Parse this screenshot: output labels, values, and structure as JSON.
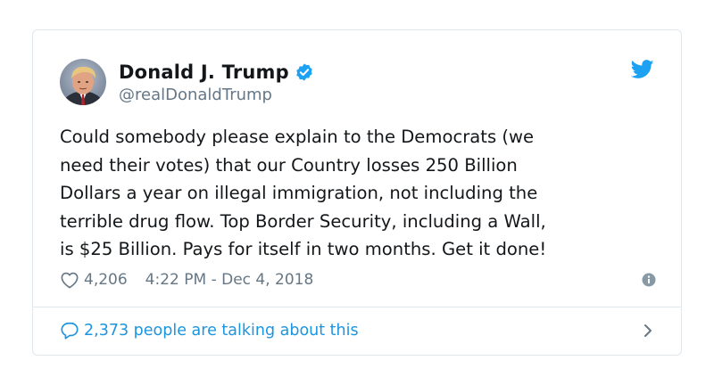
{
  "tweet": {
    "author": {
      "display_name": "Donald J. Trump",
      "handle": "@realDonaldTrump",
      "verified": true
    },
    "text": "Could somebody please explain to the Democrats (we\nneed their votes) that our Country losses 250 Billion\nDollars a year on illegal immigration, not including the\nterrible drug flow. Top Border Security, including a Wall,\nis $25 Billion. Pays for itself in two months. Get it done!",
    "likes": "4,206",
    "timestamp": "4:22 PM - Dec 4, 2018",
    "talking": "2,373 people are talking about this"
  },
  "icons": {
    "brand": "twitter-bird-icon",
    "like": "heart-icon",
    "info": "info-icon",
    "comment": "comment-icon",
    "chevron": "chevron-right-icon",
    "verified": "verified-badge-icon"
  },
  "colors": {
    "accent": "#1da1f2",
    "link": "#1b95e0",
    "secondary_text": "#657786",
    "border": "#e1e8ed"
  }
}
